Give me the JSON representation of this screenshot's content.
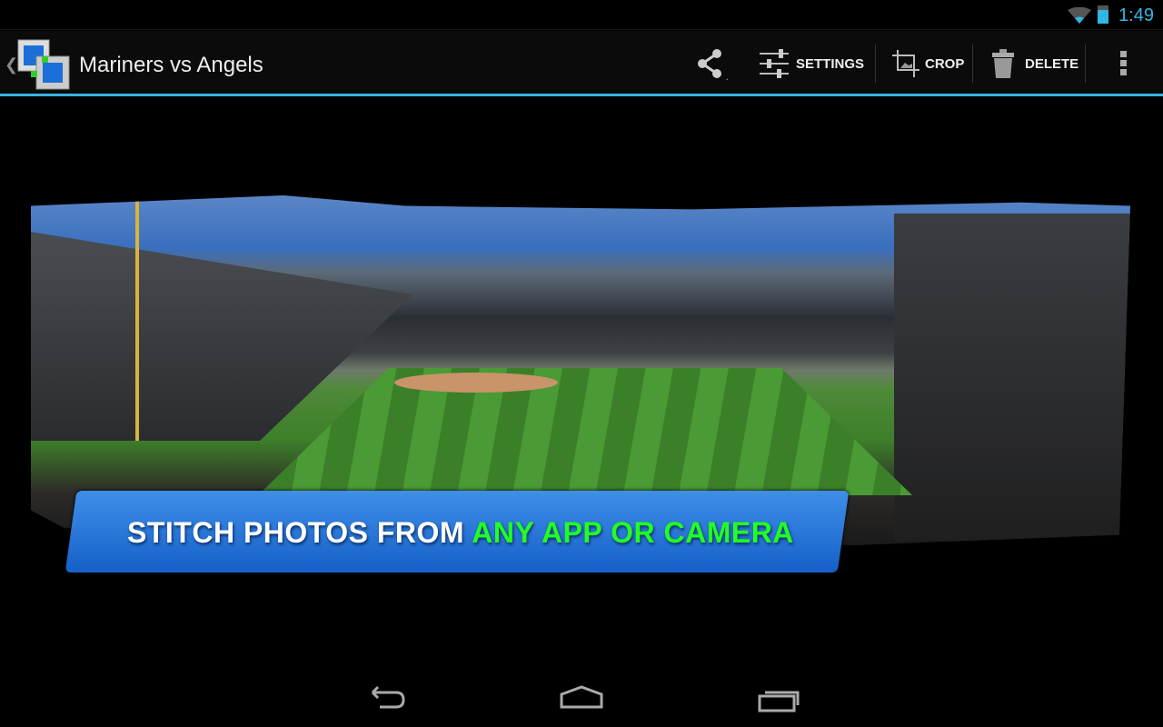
{
  "status_bar": {
    "time": "1:49",
    "icons": [
      "wifi-icon",
      "battery-charging-icon"
    ]
  },
  "action_bar": {
    "title": "Mariners vs Angels",
    "actions": [
      {
        "label": "",
        "icon": "share-icon"
      },
      {
        "label": "SETTINGS",
        "icon": "sliders-icon"
      },
      {
        "label": "CROP",
        "icon": "crop-icon"
      },
      {
        "label": "DELETE",
        "icon": "trash-icon"
      },
      {
        "label": "",
        "icon": "overflow-menu-icon"
      }
    ],
    "accent": "#33b5e5"
  },
  "banner": {
    "text_white": "STITCH PHOTOS FROM ",
    "text_green": "ANY APP OR CAMERA",
    "green": "#22ff22",
    "blue": "#1f6fd8"
  },
  "nav_bar": {
    "buttons": [
      "back-icon",
      "home-icon",
      "recents-icon"
    ]
  }
}
